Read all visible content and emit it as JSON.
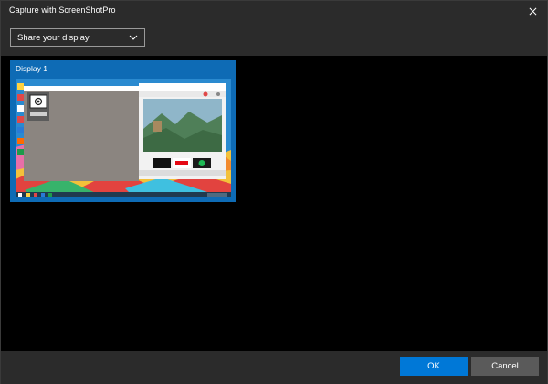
{
  "window": {
    "title": "Capture with ScreenShotPro"
  },
  "toolbar": {
    "source_select": {
      "value": "Share your display"
    }
  },
  "displays": [
    {
      "label": "Display 1",
      "selected": true
    }
  ],
  "footer": {
    "ok_label": "OK",
    "cancel_label": "Cancel"
  },
  "colors": {
    "accent": "#0078d7",
    "tile_selected": "#0e6bb5",
    "window_bg": "#2b2b2b",
    "content_bg": "#000000",
    "cancel_bg": "#5a5a5a"
  }
}
